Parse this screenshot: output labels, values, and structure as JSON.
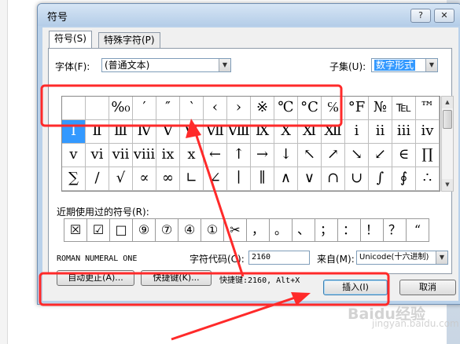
{
  "window": {
    "title": "符号",
    "help_label": "?",
    "close_label": "✕"
  },
  "tabs": [
    {
      "label": "符号(S)"
    },
    {
      "label": "特殊字符(P)"
    }
  ],
  "font": {
    "label": "字体(F):",
    "value": "(普通文本)"
  },
  "subset": {
    "label": "子集(U):",
    "value": "数字形式"
  },
  "grid_rows": [
    [
      "",
      "",
      "%₀",
      "′",
      "″",
      "‵",
      "‹",
      "›",
      "※",
      "℃",
      "°C",
      "℅",
      "°F",
      "№",
      "℡",
      "™"
    ],
    [
      "Ⅰ",
      "Ⅱ",
      "Ⅲ",
      "Ⅳ",
      "Ⅴ",
      "Ⅵ",
      "Ⅶ",
      "Ⅷ",
      "Ⅸ",
      "Ⅹ",
      "Ⅺ",
      "Ⅻ",
      "ⅰ",
      "ⅱ",
      "ⅲ",
      "ⅳ"
    ],
    [
      "ⅴ",
      "ⅵ",
      "ⅶ",
      "ⅷ",
      "ⅸ",
      "ⅹ",
      "←",
      "↑",
      "→",
      "↓",
      "↖",
      "↗",
      "↘",
      "↙",
      "∈",
      "∏"
    ],
    [
      "∑",
      "∕",
      "√",
      "∝",
      "∞",
      "∟",
      "∠",
      "∣",
      "∥",
      "∧",
      "∨",
      "∩",
      "∪",
      "∫",
      "∮",
      "∴"
    ]
  ],
  "selected_symbol": "Ⅰ",
  "recent": {
    "label": "近期使用过的符号(R):",
    "symbols": [
      "☒",
      "☑",
      "□",
      "⑨",
      "⑦",
      "④",
      "①",
      "✂",
      "，",
      "。",
      "、",
      "；",
      "：",
      "！",
      "？",
      "“"
    ]
  },
  "char_name": "ROMAN NUMERAL ONE",
  "char_code": {
    "label": "字符代码(C):",
    "value": "2160"
  },
  "from": {
    "label": "来自(M):",
    "value": "Unicode(十六进制)"
  },
  "buttons": {
    "autocorrect": "自动更正(A)...",
    "shortcut": "快捷键(K)...",
    "shortcut_text": "快捷键:2160, Alt+X",
    "insert": "插入(I)",
    "cancel": "取消"
  },
  "colors": {
    "annotation": "#ff2a2a",
    "selection": "#3399ff"
  },
  "watermark": {
    "brand": "Baidu经验",
    "url": "jingyan.baidu.com"
  }
}
